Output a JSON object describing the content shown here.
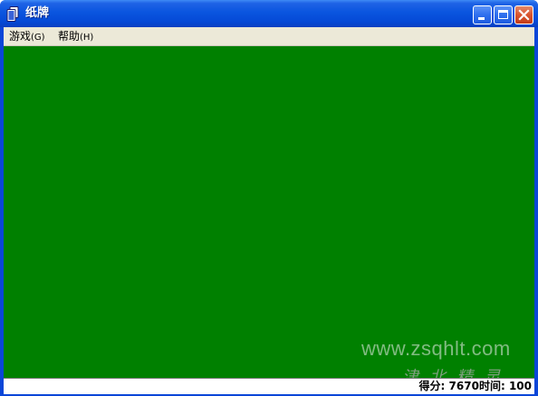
{
  "window": {
    "title": "纸牌",
    "icon": "cards-icon"
  },
  "titlebar_buttons": [
    "minimize",
    "maximize",
    "close"
  ],
  "menu": {
    "items": [
      {
        "label": "游戏",
        "accel": "(G)"
      },
      {
        "label": "帮助",
        "accel": "(H)"
      }
    ]
  },
  "table": {
    "felt_color": "#008000"
  },
  "status": {
    "score_label": "得分:",
    "score_value": "7670",
    "time_label": "时间:",
    "time_value": "100"
  },
  "watermark": {
    "url": "www.zsqhlt.com",
    "logo_text": "津北精灵"
  },
  "colors": {
    "titlebar": "#0a55df",
    "menubar": "#ece9d8",
    "close_button": "#d9542e"
  }
}
